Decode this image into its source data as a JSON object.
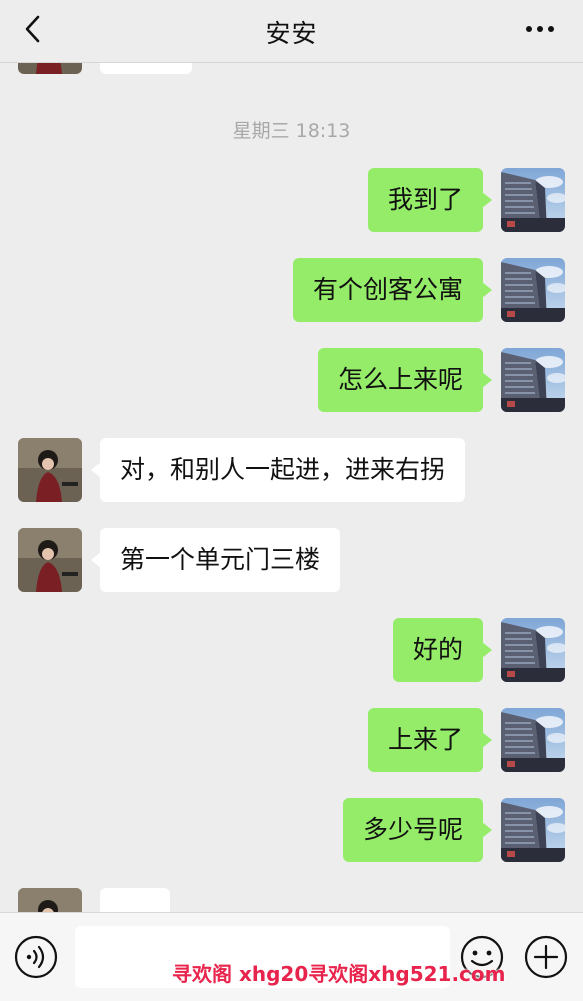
{
  "header": {
    "title": "安安"
  },
  "chat": {
    "timestamp": "星期三 18:13",
    "messages": [
      {
        "side": "out",
        "text": "我到了"
      },
      {
        "side": "out",
        "text": "有个创客公寓"
      },
      {
        "side": "out",
        "text": "怎么上来呢"
      },
      {
        "side": "in",
        "text": "对，和别人一起进，进来右拐"
      },
      {
        "side": "in",
        "text": "第一个单元门三楼"
      },
      {
        "side": "out",
        "text": "好的"
      },
      {
        "side": "out",
        "text": "上来了"
      },
      {
        "side": "out",
        "text": "多少号呢"
      }
    ]
  },
  "input": {
    "placeholder": ""
  },
  "watermark": {
    "text": "寻欢阁 xhg20寻欢阁xhg521.com"
  },
  "colors": {
    "outgoing_bubble": "#95ec69",
    "incoming_bubble": "#ffffff",
    "background": "#ededed",
    "watermark": "#e8244d"
  },
  "icons": [
    "back-icon",
    "more-icon",
    "voice-icon",
    "emoji-icon",
    "plus-icon"
  ]
}
